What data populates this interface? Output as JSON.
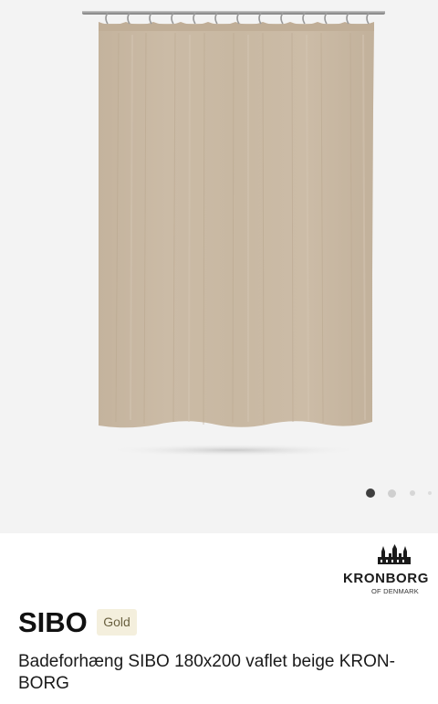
{
  "product": {
    "image_alt": "Beige vaflet badeforhæng SIBO",
    "curtain_color": "#c9b9a4",
    "gallery": {
      "total": 4,
      "active": 1
    }
  },
  "brand": {
    "logo_icon": "castle-icon",
    "name": "KRONBORG",
    "sub": "OF DENMARK"
  },
  "title": {
    "name": "SIBO",
    "badge": "Gold"
  },
  "description": "Badeforhæng SIBO 180x200 vaflet beige KRON-BORG"
}
